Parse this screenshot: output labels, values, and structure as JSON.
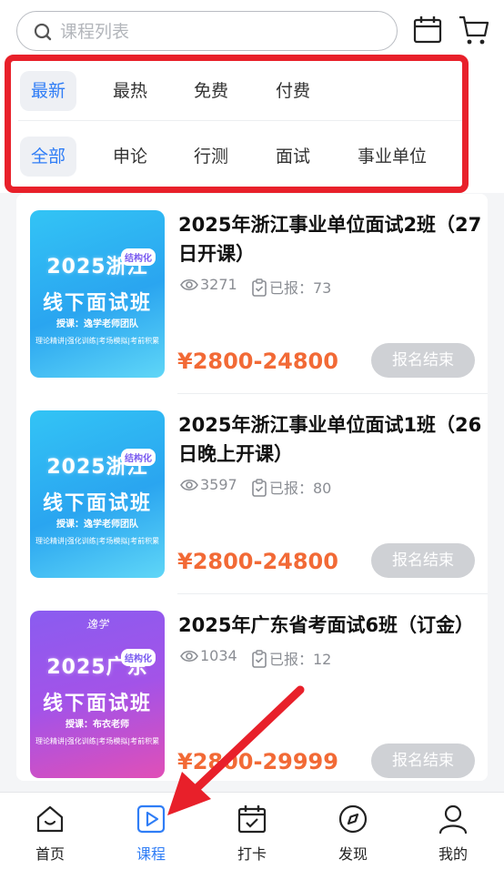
{
  "search": {
    "placeholder": "课程列表"
  },
  "filters": {
    "sort": [
      {
        "label": "最新",
        "active": true
      },
      {
        "label": "最热",
        "active": false
      },
      {
        "label": "免费",
        "active": false
      },
      {
        "label": "付费",
        "active": false
      }
    ],
    "category": [
      {
        "label": "全部",
        "active": true
      },
      {
        "label": "申论",
        "active": false
      },
      {
        "label": "行测",
        "active": false
      },
      {
        "label": "面试",
        "active": false
      },
      {
        "label": "事业单位",
        "active": false
      }
    ]
  },
  "courses": [
    {
      "title": "2025年浙江事业单位面试2班（27日开课）",
      "views": "3271",
      "enrolled": "已报：73",
      "price": "¥2800-24800",
      "status": "报名结束",
      "thumb": {
        "year_region": "2025浙江",
        "tag": "结构化",
        "headline": "线下面试班",
        "teacher": "授课：逸学老师团队",
        "strip": "理论精讲|强化训练|考场模拟|考前积累"
      }
    },
    {
      "title": "2025年浙江事业单位面试1班（26日晚上开课）",
      "views": "3597",
      "enrolled": "已报：80",
      "price": "¥2800-24800",
      "status": "报名结束",
      "thumb": {
        "year_region": "2025浙江",
        "tag": "结构化",
        "headline": "线下面试班",
        "teacher": "授课：逸学老师团队",
        "strip": "理论精讲|强化训练|考场模拟|考前积累"
      }
    },
    {
      "title": "2025年广东省考面试6班（订金）",
      "views": "1034",
      "enrolled": "已报：12",
      "price": "¥2800-29999",
      "status": "报名结束",
      "thumb": {
        "logo": "逸学",
        "year_region": "2025广东",
        "tag": "结构化",
        "headline": "线下面试班",
        "teacher": "授课：布衣老师",
        "strip": "理论精讲|强化训练|考场模拟|考前积累"
      }
    }
  ],
  "nav": [
    {
      "label": "首页",
      "icon": "home-icon",
      "active": false
    },
    {
      "label": "课程",
      "icon": "play-icon",
      "active": true
    },
    {
      "label": "打卡",
      "icon": "calendar-check-icon",
      "active": false
    },
    {
      "label": "发现",
      "icon": "compass-icon",
      "active": false
    },
    {
      "label": "我的",
      "icon": "user-icon",
      "active": false
    }
  ],
  "colors": {
    "accent": "#2f7df6",
    "price": "#f26a36",
    "highlight": "#e8202a"
  }
}
